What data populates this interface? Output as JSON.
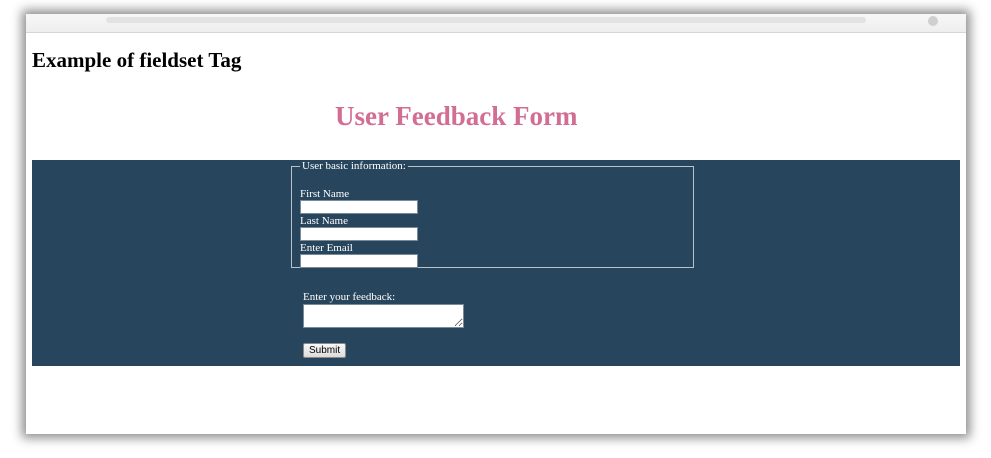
{
  "page": {
    "heading": "Example of fieldset Tag",
    "form_title": "User Feedback Form"
  },
  "fieldset": {
    "legend": "User basic information:",
    "fields": [
      {
        "label": "First Name",
        "value": ""
      },
      {
        "label": "Last Name",
        "value": ""
      },
      {
        "label": "Enter Email",
        "value": ""
      }
    ]
  },
  "feedback": {
    "label": "Enter your feedback:",
    "value": ""
  },
  "submit": {
    "label": "Submit"
  },
  "colors": {
    "form_title": "#d26e93",
    "panel_background": "#27455c",
    "text_on_panel": "#ffffff"
  }
}
